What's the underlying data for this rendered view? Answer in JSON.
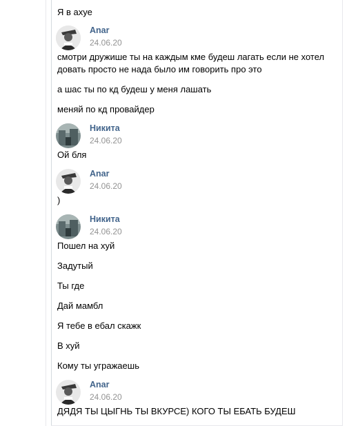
{
  "messages_top": {
    "text": "Я в ахуе"
  },
  "groups": [
    {
      "author": "Anar",
      "date": "24.06.20",
      "avatar": "anar-avatar",
      "lines": [
        "смотри дружише ты на каждым кме будеш лагать если не хотел довать просто не нада было им говорить про это",
        "а шас ты по кд будеш у меня лашать",
        "меняй по кд провайдер"
      ]
    },
    {
      "author": "Никита",
      "date": "24.06.20",
      "avatar": "nikita-avatar",
      "lines": [
        "Ой бля"
      ]
    },
    {
      "author": "Anar",
      "date": "24.06.20",
      "avatar": "anar-avatar",
      "lines": [
        ")"
      ]
    },
    {
      "author": "Никита",
      "date": "24.06.20",
      "avatar": "nikita-avatar",
      "lines": [
        "Пошел на хуй",
        "Задутый",
        "Ты где",
        "Дай мамбл",
        "Я тебе в ебал скажк",
        "В хуй",
        "Кому ты угражаешь"
      ]
    },
    {
      "author": "Anar",
      "date": "24.06.20",
      "avatar": "anar-avatar",
      "lines": [
        "ДЯДЯ ТЫ ЦЫГНЬ ТЫ ВКУРСЕ) КОГО ТЫ ЕБАТЬ БУДЕШ"
      ]
    }
  ],
  "colors": {
    "author_name": "#42648b",
    "date": "#939393",
    "text": "#000000",
    "divider": "#e7e8ec"
  }
}
